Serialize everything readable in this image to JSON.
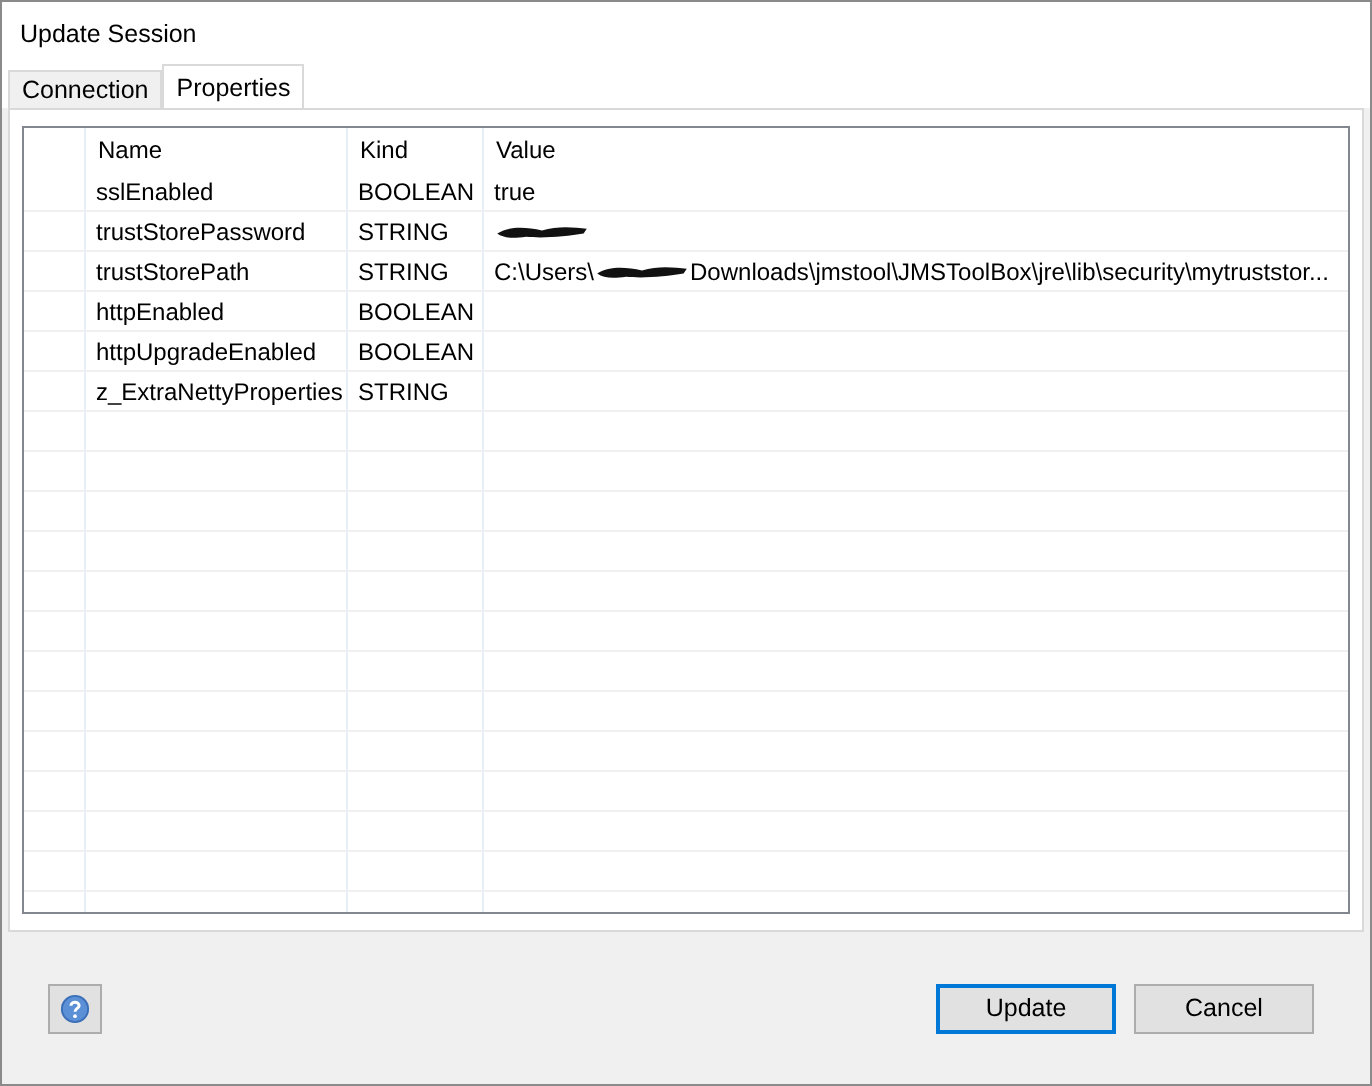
{
  "window": {
    "title": "Update Session"
  },
  "tabs": [
    {
      "label": "Connection",
      "selected": false
    },
    {
      "label": "Properties",
      "selected": true
    }
  ],
  "table": {
    "columns": [
      "Name",
      "Kind",
      "Value"
    ],
    "rows": [
      {
        "name": "sslEnabled",
        "kind": "BOOLEAN",
        "value_segments": [
          {
            "kind": "text",
            "text": "true"
          }
        ]
      },
      {
        "name": "trustStorePassword",
        "kind": "STRING",
        "value_segments": [
          {
            "kind": "redacted"
          }
        ]
      },
      {
        "name": "trustStorePath",
        "kind": "STRING",
        "value_segments": [
          {
            "kind": "text",
            "text": "C:\\Users\\"
          },
          {
            "kind": "redacted"
          },
          {
            "kind": "text",
            "text": "Downloads\\jmstool\\JMSToolBox\\jre\\lib\\security\\mytruststor..."
          }
        ]
      },
      {
        "name": "httpEnabled",
        "kind": "BOOLEAN",
        "value_segments": []
      },
      {
        "name": "httpUpgradeEnabled",
        "kind": "BOOLEAN",
        "value_segments": []
      },
      {
        "name": "z_ExtraNettyProperties",
        "kind": "STRING",
        "value_segments": []
      }
    ]
  },
  "buttons": [
    {
      "label": "Update",
      "default": true
    },
    {
      "label": "Cancel",
      "default": false
    }
  ]
}
